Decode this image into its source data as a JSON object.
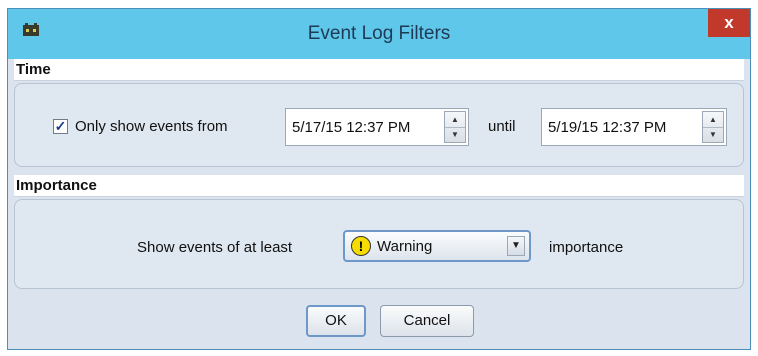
{
  "window": {
    "title": "Event Log Filters",
    "close_glyph": "x",
    "app_icon": "app-icon"
  },
  "time": {
    "section_label": "Time",
    "only_show_checked": true,
    "only_show_label": "Only show events from",
    "from_value": "5/17/15 12:37 PM",
    "until_label": "until",
    "until_value": "5/19/15 12:37 PM"
  },
  "importance": {
    "section_label": "Importance",
    "prefix_label": "Show events of at least",
    "selected_level": "Warning",
    "level_icon": "warning-icon",
    "suffix_label": "importance"
  },
  "buttons": {
    "ok_label": "OK",
    "cancel_label": "Cancel"
  },
  "colors": {
    "titlebar": "#5ec7ea",
    "close": "#c0392b",
    "warning": "#f6dc00"
  }
}
